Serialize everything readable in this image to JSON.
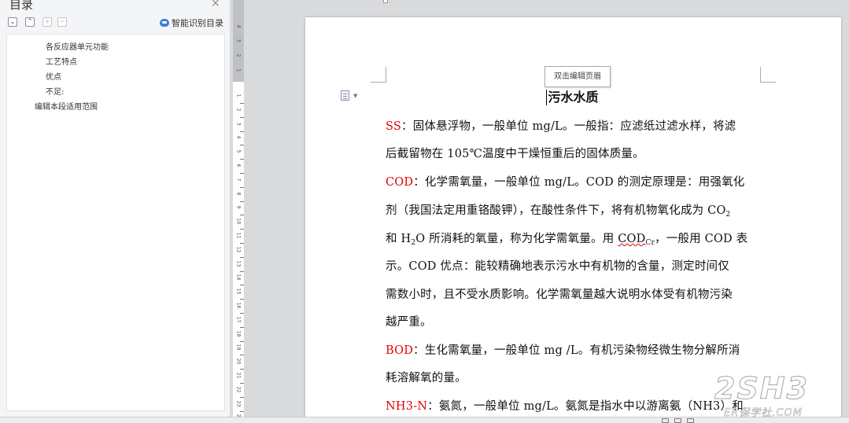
{
  "toc": {
    "title": "目录",
    "close": "×",
    "toolbar": {
      "expand": "⌄",
      "collapse": "⌃",
      "add": "+",
      "remove": "−"
    },
    "smart_label": "智能识别目录",
    "items": [
      {
        "label": "各反应器单元功能",
        "level": 2
      },
      {
        "label": "工艺特点",
        "level": 2
      },
      {
        "label": "优点",
        "level": 2
      },
      {
        "label": "不足:",
        "level": 2
      },
      {
        "label": "编辑本段适用范围",
        "level": 1
      }
    ]
  },
  "ruler": {
    "top_numbers": [
      "4",
      "3",
      "2",
      "1"
    ],
    "numbers": [
      "1",
      "2",
      "3",
      "4",
      "5",
      "6",
      "7",
      "8",
      "9",
      "10",
      "11",
      "12",
      "13",
      "14",
      "15",
      "16",
      "17",
      "18",
      "19",
      "20",
      "21",
      "22",
      "23",
      "24"
    ]
  },
  "document": {
    "header_hint": "双击编辑页眉",
    "title": "污水水质",
    "lines": [
      {
        "term": "SS",
        "text": "：固体悬浮物，一般单位 mg/L。一般指：应滤纸过滤水样，将滤"
      },
      {
        "text": "后截留物在 105℃温度中干燥恒重后的固体质量。"
      },
      {
        "term": "COD",
        "text": "：化学需氧量，一般单位 mg/L。COD 的测定原理是：用强氧化"
      },
      {
        "text": "剂（我国法定用重铬酸钾），在酸性条件下，将有机物氧化成为 CO",
        "sub": "2"
      },
      {
        "pre": "和 H",
        "sub_mid": "2",
        "post": "O 所消耗的氧量，称为化学需氧量。用 ",
        "wavy": "COD",
        "wavy_sub": "Cr",
        "tail": "，一般用 COD 表"
      },
      {
        "text": "示。COD 优点：能较精确地表示污水中有机物的含量，测定时间仅"
      },
      {
        "text": "需数小时，且不受水质影响。化学需氧量越大说明水体受有机物污染"
      },
      {
        "text": "越严重。"
      },
      {
        "term": "BOD",
        "text": "：生化需氧量，一般单位 mg /L。有机污染物经微生物分解所消"
      },
      {
        "text": "耗溶解氧的量。"
      },
      {
        "term": "NH3-N",
        "text": "：氨氮，一般单位 mg/L。氨氮是指水中以游离氨（NH3）和"
      }
    ]
  },
  "watermark": {
    "main": "2SH3",
    "sub": "ER保学社.COM"
  },
  "colors": {
    "term_red": "#e00000",
    "panel_bg": "#f4f5f7",
    "canvas_bg": "#d9dadc",
    "accent_blue": "#3b7ddd"
  }
}
